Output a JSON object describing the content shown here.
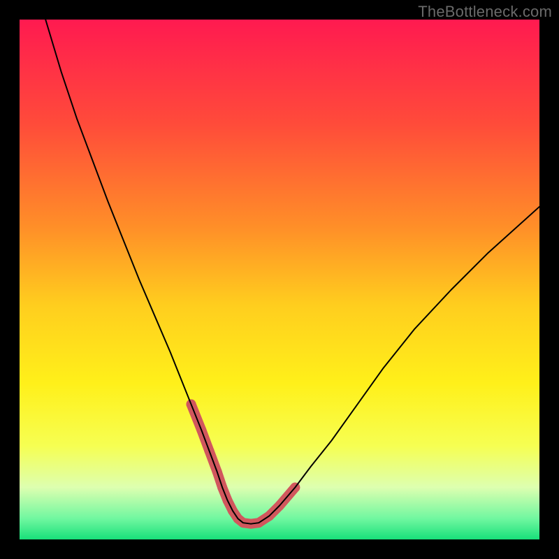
{
  "watermark": "TheBottleneck.com",
  "chart_data": {
    "type": "line",
    "title": "",
    "xlabel": "",
    "ylabel": "",
    "xlim": [
      0,
      100
    ],
    "ylim": [
      0,
      100
    ],
    "grid": false,
    "legend": false,
    "annotations": [],
    "background_gradient": {
      "type": "vertical",
      "stops": [
        {
          "pos": 0.0,
          "color": "#ff1a50"
        },
        {
          "pos": 0.2,
          "color": "#ff4b3a"
        },
        {
          "pos": 0.4,
          "color": "#ff8f28"
        },
        {
          "pos": 0.55,
          "color": "#ffce1e"
        },
        {
          "pos": 0.7,
          "color": "#fff01a"
        },
        {
          "pos": 0.82,
          "color": "#f6ff52"
        },
        {
          "pos": 0.9,
          "color": "#ddffb0"
        },
        {
          "pos": 0.96,
          "color": "#70f7a0"
        },
        {
          "pos": 1.0,
          "color": "#18e07a"
        }
      ]
    },
    "series": [
      {
        "name": "bottleneck-curve",
        "color": "#000000",
        "width": 2,
        "x": [
          5,
          8,
          11,
          14,
          17,
          20,
          23,
          26,
          29,
          31,
          33,
          35,
          36.5,
          38,
          39,
          40,
          41,
          42,
          43,
          44.5,
          46,
          48,
          50,
          53,
          56,
          60,
          65,
          70,
          76,
          83,
          90,
          100
        ],
        "y": [
          100,
          90,
          81,
          73,
          65,
          57.5,
          50,
          43,
          36,
          31,
          26,
          21,
          17,
          13,
          10,
          7.5,
          5.5,
          4,
          3.2,
          3.0,
          3.2,
          4.5,
          6.5,
          10,
          14,
          19,
          26,
          33,
          40.5,
          48,
          55,
          64
        ]
      }
    ],
    "highlight_band": {
      "name": "valley-highlight",
      "color": "#d1575d",
      "width": 14,
      "x": [
        33,
        35,
        36.5,
        38,
        39,
        40,
        41,
        42,
        43,
        44.5,
        46,
        48,
        50,
        53
      ],
      "y": [
        26,
        21,
        17,
        13,
        10,
        7.5,
        5.5,
        4,
        3.2,
        3.0,
        3.2,
        4.5,
        6.5,
        10
      ]
    }
  }
}
